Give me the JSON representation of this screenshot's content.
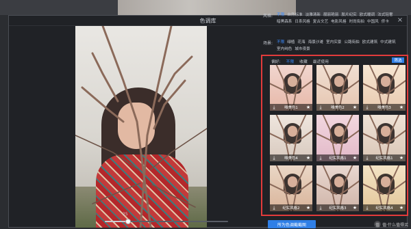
{
  "window": {
    "title": "色调库"
  },
  "panel": {
    "filters": [
      {
        "label": "风格:",
        "items": [
          "不限",
          "自然标准",
          "淡雅清新",
          "靓丽艳丽",
          "胶片纪实",
          "欧式暖调",
          "法式轻奢",
          "暗黑森系",
          "日系风格",
          "复古文艺",
          "电影风格",
          "时尚街拍",
          "中国风",
          "侨卡"
        ]
      },
      {
        "label": "场景:",
        "items": [
          "不限",
          "绿植",
          "花海",
          "海景沙滩",
          "室内实景",
          "公路街拍",
          "欧式建筑",
          "中式建筑",
          "室内纯色",
          "城市夜景"
        ]
      }
    ],
    "tabs": [
      "偏好:",
      "不限",
      "收藏",
      "最近使用"
    ],
    "filter_button": "筛选",
    "tiles": [
      {
        "label": "唯美色1"
      },
      {
        "label": "唯美色2"
      },
      {
        "label": "唯美色3"
      },
      {
        "label": "唯美色4"
      },
      {
        "label": "纪实风格1"
      },
      {
        "label": "纪实风格1"
      },
      {
        "label": "纪实风格2"
      },
      {
        "label": "纪实风格3"
      },
      {
        "label": "纪实风格4"
      }
    ]
  },
  "editor": {
    "slider_value": "25",
    "slider_fraction": 0.19
  },
  "actions": {
    "apply_button": "所为色调截截图"
  },
  "watermark": {
    "text": "值·什么值得买"
  },
  "colors": {
    "accent": "#2f7fe6",
    "highlight": "#e33b3b"
  }
}
